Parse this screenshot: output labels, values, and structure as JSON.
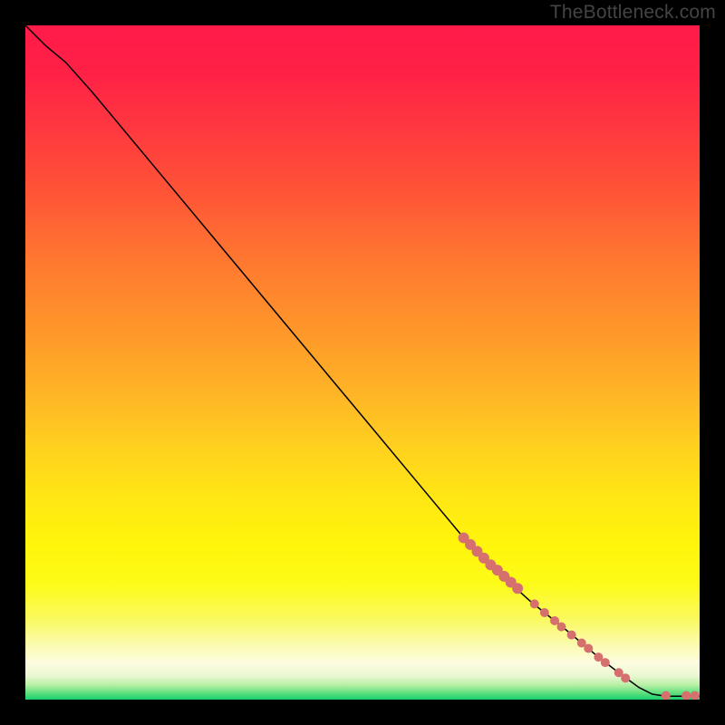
{
  "watermark": "TheBottleneck.com",
  "gradient_stops": [
    {
      "offset": 0.0,
      "color": "#ff1a4a"
    },
    {
      "offset": 0.07,
      "color": "#ff2146"
    },
    {
      "offset": 0.15,
      "color": "#ff3740"
    },
    {
      "offset": 0.25,
      "color": "#ff5536"
    },
    {
      "offset": 0.35,
      "color": "#ff7830"
    },
    {
      "offset": 0.45,
      "color": "#ff962a"
    },
    {
      "offset": 0.55,
      "color": "#ffb626"
    },
    {
      "offset": 0.63,
      "color": "#ffd21e"
    },
    {
      "offset": 0.7,
      "color": "#ffe614"
    },
    {
      "offset": 0.77,
      "color": "#fff50a"
    },
    {
      "offset": 0.83,
      "color": "#fdfb1a"
    },
    {
      "offset": 0.88,
      "color": "#faf95e"
    },
    {
      "offset": 0.915,
      "color": "#fbfba8"
    },
    {
      "offset": 0.945,
      "color": "#fdfce0"
    },
    {
      "offset": 0.965,
      "color": "#e9f8d2"
    },
    {
      "offset": 0.978,
      "color": "#b9f0a6"
    },
    {
      "offset": 0.99,
      "color": "#5fe07e"
    },
    {
      "offset": 1.0,
      "color": "#18cf6e"
    }
  ],
  "chart_data": {
    "type": "line",
    "title": "",
    "xlabel": "",
    "ylabel": "",
    "xlim": [
      0,
      100
    ],
    "ylim": [
      0,
      100
    ],
    "curve": {
      "name": "bottleneck-curve",
      "points": [
        {
          "x": 0,
          "y": 100
        },
        {
          "x": 3,
          "y": 97
        },
        {
          "x": 6,
          "y": 94.5
        },
        {
          "x": 10,
          "y": 90
        },
        {
          "x": 20,
          "y": 78
        },
        {
          "x": 30,
          "y": 66
        },
        {
          "x": 40,
          "y": 54
        },
        {
          "x": 50,
          "y": 42
        },
        {
          "x": 60,
          "y": 30
        },
        {
          "x": 65,
          "y": 24
        },
        {
          "x": 70,
          "y": 19
        },
        {
          "x": 75,
          "y": 14.5
        },
        {
          "x": 80,
          "y": 10.5
        },
        {
          "x": 85,
          "y": 6.3
        },
        {
          "x": 88,
          "y": 4.0
        },
        {
          "x": 91,
          "y": 1.8
        },
        {
          "x": 93,
          "y": 0.8
        },
        {
          "x": 95,
          "y": 0.5
        },
        {
          "x": 97,
          "y": 0.5
        },
        {
          "x": 99,
          "y": 0.5
        },
        {
          "x": 100,
          "y": 0.5
        }
      ]
    },
    "markers": {
      "name": "highlight-markers",
      "color": "#d6706e",
      "points": [
        {
          "x": 65.0,
          "y": 24.0,
          "r": 6
        },
        {
          "x": 66.0,
          "y": 23.0,
          "r": 6
        },
        {
          "x": 67.0,
          "y": 22.0,
          "r": 6
        },
        {
          "x": 68.0,
          "y": 21.0,
          "r": 6
        },
        {
          "x": 69.0,
          "y": 20.0,
          "r": 6
        },
        {
          "x": 70.0,
          "y": 19.2,
          "r": 6
        },
        {
          "x": 71.0,
          "y": 18.3,
          "r": 6
        },
        {
          "x": 72.0,
          "y": 17.4,
          "r": 6
        },
        {
          "x": 73.0,
          "y": 16.5,
          "r": 6
        },
        {
          "x": 75.5,
          "y": 14.2,
          "r": 5
        },
        {
          "x": 77.0,
          "y": 12.9,
          "r": 5
        },
        {
          "x": 78.5,
          "y": 11.7,
          "r": 5
        },
        {
          "x": 79.5,
          "y": 10.8,
          "r": 5
        },
        {
          "x": 81.0,
          "y": 9.6,
          "r": 5
        },
        {
          "x": 82.5,
          "y": 8.4,
          "r": 5
        },
        {
          "x": 83.5,
          "y": 7.6,
          "r": 5
        },
        {
          "x": 85.0,
          "y": 6.3,
          "r": 5
        },
        {
          "x": 86.0,
          "y": 5.5,
          "r": 5
        },
        {
          "x": 88.0,
          "y": 4.0,
          "r": 5
        },
        {
          "x": 89.0,
          "y": 3.2,
          "r": 5
        },
        {
          "x": 95.0,
          "y": 0.6,
          "r": 5
        },
        {
          "x": 98.0,
          "y": 0.6,
          "r": 5
        },
        {
          "x": 99.3,
          "y": 0.6,
          "r": 5
        }
      ]
    }
  }
}
